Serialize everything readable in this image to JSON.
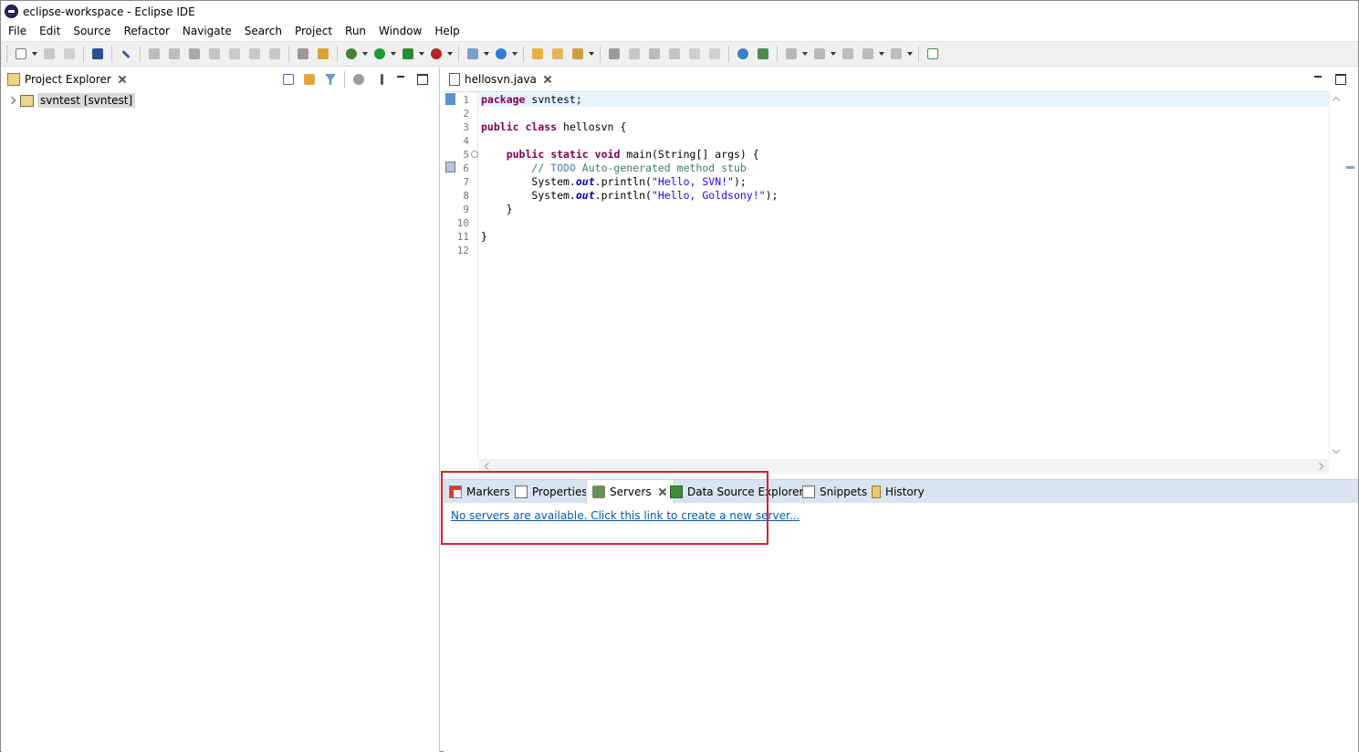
{
  "window": {
    "title": "eclipse-workspace - Eclipse IDE"
  },
  "menu": [
    "File",
    "Edit",
    "Source",
    "Refactor",
    "Navigate",
    "Search",
    "Project",
    "Run",
    "Window",
    "Help"
  ],
  "explorer": {
    "tab_label": "Project Explorer",
    "items": [
      {
        "label": "svntest [svntest]"
      }
    ]
  },
  "editor": {
    "tab_label": "hellosvn.java",
    "line_numbers": [
      "1",
      "2",
      "3",
      "4",
      "5",
      "6",
      "7",
      "8",
      "9",
      "10",
      "11",
      "12"
    ],
    "code": {
      "l1_kw": "package",
      "l1_rest": " svntest;",
      "l3_kw1": "public",
      "l3_kw2": "class",
      "l3_rest": " hellosvn {",
      "l5_indent": "    ",
      "l5_kw1": "public",
      "l5_kw2": "static",
      "l5_kw3": "void",
      "l5_rest": " main(String[] args) {",
      "l6_indent": "        ",
      "l6_comment_start": "// ",
      "l6_todo": "TODO",
      "l6_comment_rest": " Auto-generated method stub",
      "l7_indent": "        ",
      "l7_pre": "System.",
      "l7_field": "out",
      "l7_mid": ".println(",
      "l7_str": "\"Hello, SVN!\"",
      "l7_end": ");",
      "l8_indent": "        ",
      "l8_pre": "System.",
      "l8_field": "out",
      "l8_mid": ".println(",
      "l8_str": "\"Hello, Goldsony!\"",
      "l8_end": ");",
      "l9": "    }",
      "l11": "}"
    }
  },
  "bottom": {
    "tabs": [
      {
        "label": "Markers"
      },
      {
        "label": "Properties"
      },
      {
        "label": "Servers"
      },
      {
        "label": "Data Source Explorer"
      },
      {
        "label": "Snippets"
      },
      {
        "label": "History"
      }
    ],
    "servers_link": "No servers are available. Click this link to create a new server..."
  },
  "colors": {
    "highlight": "#d9212a",
    "link": "#0b57a8",
    "keyword": "#7f0055",
    "comment": "#3f7f5f",
    "string": "#2a00ff"
  }
}
